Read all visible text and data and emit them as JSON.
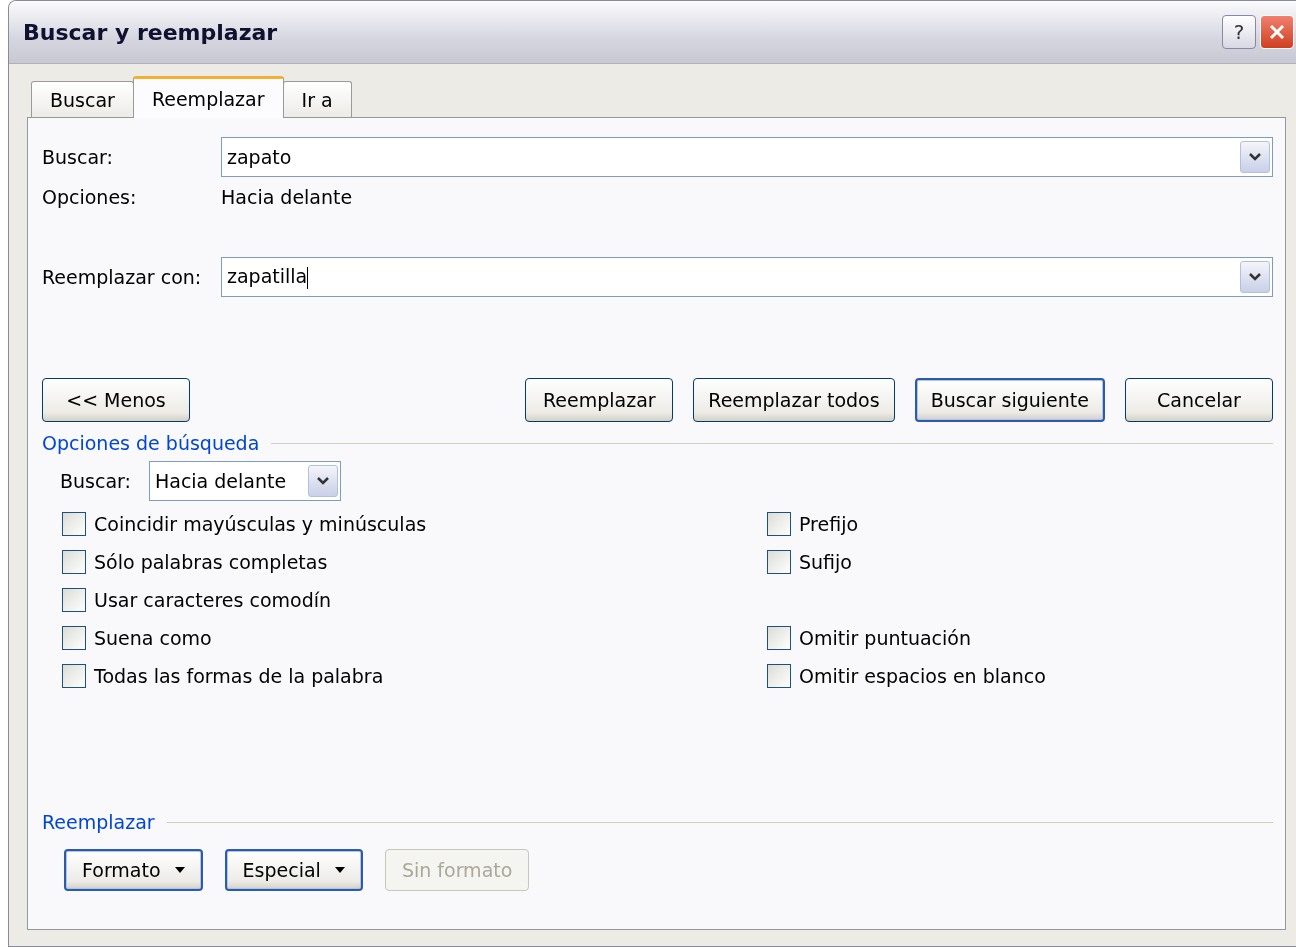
{
  "window": {
    "title": "Buscar y reemplazar"
  },
  "title_buttons": [
    {
      "kind": "help",
      "label": "?"
    },
    {
      "kind": "close"
    }
  ],
  "tabs": [
    {
      "label": "Buscar",
      "selected": false
    },
    {
      "label": "Reemplazar",
      "selected": true
    },
    {
      "label": "Ir a",
      "selected": false
    }
  ],
  "find": {
    "label": "Buscar:",
    "value": "zapato"
  },
  "options": {
    "label": "Opciones:",
    "value": "Hacia delante"
  },
  "replace": {
    "label": "Reemplazar con:",
    "value": "zapatilla"
  },
  "less_button": "<< Menos",
  "action_buttons": [
    {
      "label": "Reemplazar",
      "default": false
    },
    {
      "label": "Reemplazar todos",
      "default": false
    },
    {
      "label": "Buscar siguiente",
      "default": true
    },
    {
      "label": "Cancelar",
      "default": false
    }
  ],
  "search_options": {
    "title": "Opciones de búsqueda",
    "direction": {
      "label": "Buscar:",
      "value": "Hacia delante"
    },
    "rows": [
      {
        "left": {
          "label": "Coincidir mayúsculas y minúsculas",
          "checked": false
        },
        "right": {
          "label": "Prefijo",
          "checked": false
        }
      },
      {
        "left": {
          "label": "Sólo palabras completas",
          "checked": false
        },
        "right": {
          "label": "Sufijo",
          "checked": false
        }
      },
      {
        "left": {
          "label": "Usar caracteres comodín",
          "checked": false
        }
      },
      {
        "left": {
          "label": "Suena como",
          "checked": false
        },
        "right": {
          "label": "Omitir puntuación",
          "checked": false
        }
      },
      {
        "left": {
          "label": "Todas las formas de la palabra",
          "checked": false
        },
        "right": {
          "label": "Omitir espacios en blanco",
          "checked": false
        }
      }
    ]
  },
  "replace_section": {
    "title": "Reemplazar",
    "buttons": [
      {
        "label": "Formato",
        "dropdown": true,
        "disabled": false
      },
      {
        "label": "Especial",
        "dropdown": true,
        "disabled": false
      },
      {
        "label": "Sin formato",
        "dropdown": false,
        "disabled": true
      }
    ]
  }
}
